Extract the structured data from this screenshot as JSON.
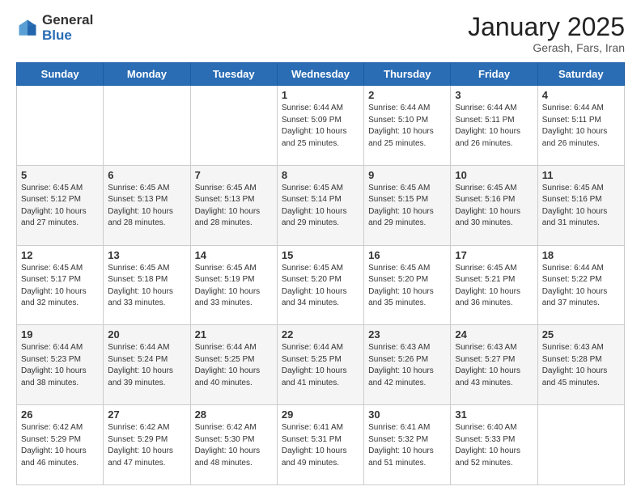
{
  "header": {
    "logo_general": "General",
    "logo_blue": "Blue",
    "month_title": "January 2025",
    "subtitle": "Gerash, Fars, Iran"
  },
  "weekdays": [
    "Sunday",
    "Monday",
    "Tuesday",
    "Wednesday",
    "Thursday",
    "Friday",
    "Saturday"
  ],
  "weeks": [
    [
      {
        "day": "",
        "info": ""
      },
      {
        "day": "",
        "info": ""
      },
      {
        "day": "",
        "info": ""
      },
      {
        "day": "1",
        "info": "Sunrise: 6:44 AM\nSunset: 5:09 PM\nDaylight: 10 hours\nand 25 minutes."
      },
      {
        "day": "2",
        "info": "Sunrise: 6:44 AM\nSunset: 5:10 PM\nDaylight: 10 hours\nand 25 minutes."
      },
      {
        "day": "3",
        "info": "Sunrise: 6:44 AM\nSunset: 5:11 PM\nDaylight: 10 hours\nand 26 minutes."
      },
      {
        "day": "4",
        "info": "Sunrise: 6:44 AM\nSunset: 5:11 PM\nDaylight: 10 hours\nand 26 minutes."
      }
    ],
    [
      {
        "day": "5",
        "info": "Sunrise: 6:45 AM\nSunset: 5:12 PM\nDaylight: 10 hours\nand 27 minutes."
      },
      {
        "day": "6",
        "info": "Sunrise: 6:45 AM\nSunset: 5:13 PM\nDaylight: 10 hours\nand 28 minutes."
      },
      {
        "day": "7",
        "info": "Sunrise: 6:45 AM\nSunset: 5:13 PM\nDaylight: 10 hours\nand 28 minutes."
      },
      {
        "day": "8",
        "info": "Sunrise: 6:45 AM\nSunset: 5:14 PM\nDaylight: 10 hours\nand 29 minutes."
      },
      {
        "day": "9",
        "info": "Sunrise: 6:45 AM\nSunset: 5:15 PM\nDaylight: 10 hours\nand 29 minutes."
      },
      {
        "day": "10",
        "info": "Sunrise: 6:45 AM\nSunset: 5:16 PM\nDaylight: 10 hours\nand 30 minutes."
      },
      {
        "day": "11",
        "info": "Sunrise: 6:45 AM\nSunset: 5:16 PM\nDaylight: 10 hours\nand 31 minutes."
      }
    ],
    [
      {
        "day": "12",
        "info": "Sunrise: 6:45 AM\nSunset: 5:17 PM\nDaylight: 10 hours\nand 32 minutes."
      },
      {
        "day": "13",
        "info": "Sunrise: 6:45 AM\nSunset: 5:18 PM\nDaylight: 10 hours\nand 33 minutes."
      },
      {
        "day": "14",
        "info": "Sunrise: 6:45 AM\nSunset: 5:19 PM\nDaylight: 10 hours\nand 33 minutes."
      },
      {
        "day": "15",
        "info": "Sunrise: 6:45 AM\nSunset: 5:20 PM\nDaylight: 10 hours\nand 34 minutes."
      },
      {
        "day": "16",
        "info": "Sunrise: 6:45 AM\nSunset: 5:20 PM\nDaylight: 10 hours\nand 35 minutes."
      },
      {
        "day": "17",
        "info": "Sunrise: 6:45 AM\nSunset: 5:21 PM\nDaylight: 10 hours\nand 36 minutes."
      },
      {
        "day": "18",
        "info": "Sunrise: 6:44 AM\nSunset: 5:22 PM\nDaylight: 10 hours\nand 37 minutes."
      }
    ],
    [
      {
        "day": "19",
        "info": "Sunrise: 6:44 AM\nSunset: 5:23 PM\nDaylight: 10 hours\nand 38 minutes."
      },
      {
        "day": "20",
        "info": "Sunrise: 6:44 AM\nSunset: 5:24 PM\nDaylight: 10 hours\nand 39 minutes."
      },
      {
        "day": "21",
        "info": "Sunrise: 6:44 AM\nSunset: 5:25 PM\nDaylight: 10 hours\nand 40 minutes."
      },
      {
        "day": "22",
        "info": "Sunrise: 6:44 AM\nSunset: 5:25 PM\nDaylight: 10 hours\nand 41 minutes."
      },
      {
        "day": "23",
        "info": "Sunrise: 6:43 AM\nSunset: 5:26 PM\nDaylight: 10 hours\nand 42 minutes."
      },
      {
        "day": "24",
        "info": "Sunrise: 6:43 AM\nSunset: 5:27 PM\nDaylight: 10 hours\nand 43 minutes."
      },
      {
        "day": "25",
        "info": "Sunrise: 6:43 AM\nSunset: 5:28 PM\nDaylight: 10 hours\nand 45 minutes."
      }
    ],
    [
      {
        "day": "26",
        "info": "Sunrise: 6:42 AM\nSunset: 5:29 PM\nDaylight: 10 hours\nand 46 minutes."
      },
      {
        "day": "27",
        "info": "Sunrise: 6:42 AM\nSunset: 5:29 PM\nDaylight: 10 hours\nand 47 minutes."
      },
      {
        "day": "28",
        "info": "Sunrise: 6:42 AM\nSunset: 5:30 PM\nDaylight: 10 hours\nand 48 minutes."
      },
      {
        "day": "29",
        "info": "Sunrise: 6:41 AM\nSunset: 5:31 PM\nDaylight: 10 hours\nand 49 minutes."
      },
      {
        "day": "30",
        "info": "Sunrise: 6:41 AM\nSunset: 5:32 PM\nDaylight: 10 hours\nand 51 minutes."
      },
      {
        "day": "31",
        "info": "Sunrise: 6:40 AM\nSunset: 5:33 PM\nDaylight: 10 hours\nand 52 minutes."
      },
      {
        "day": "",
        "info": ""
      }
    ]
  ]
}
